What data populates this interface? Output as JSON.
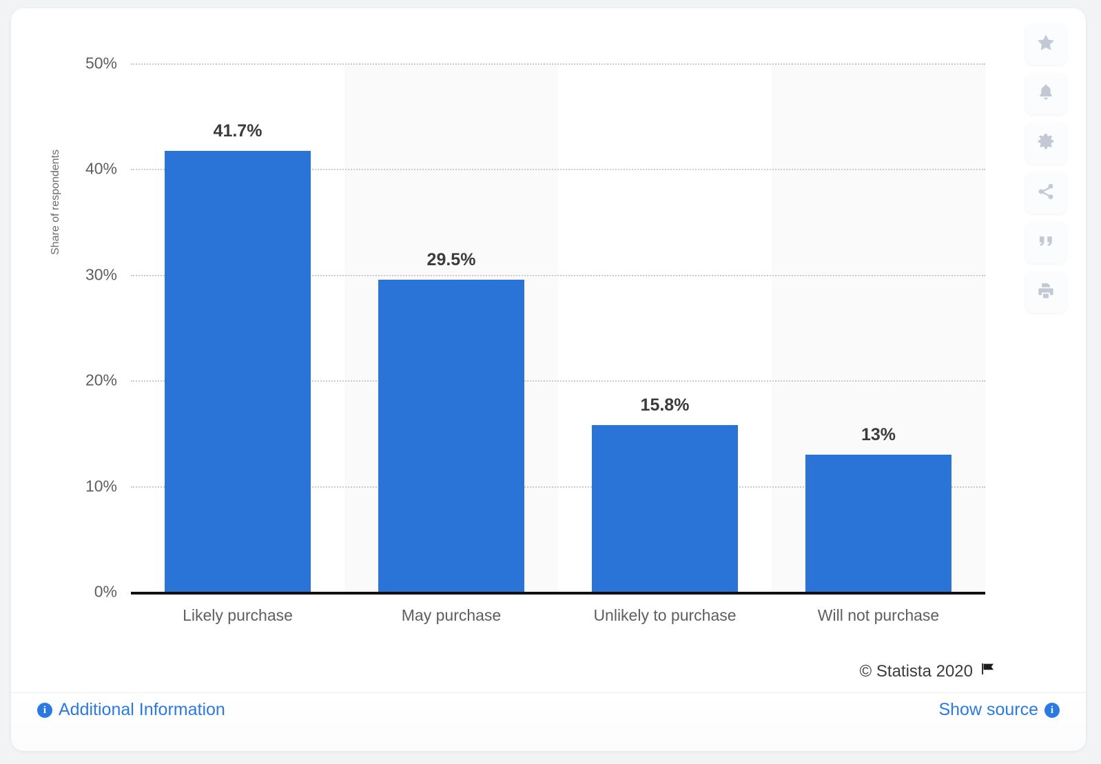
{
  "chart_data": {
    "type": "bar",
    "title": "",
    "xlabel": "",
    "ylabel": "Share of respondents",
    "ylim": [
      0,
      50
    ],
    "grid": true,
    "legend": "none",
    "categories": [
      "Likely purchase",
      "May purchase",
      "Unlikely to purchase",
      "Will not purchase"
    ],
    "values": [
      41.7,
      29.5,
      15.8,
      13
    ],
    "value_labels": [
      "41.7%",
      "29.5%",
      "15.8%",
      "13%"
    ],
    "y_ticks": [
      "0%",
      "10%",
      "20%",
      "30%",
      "40%",
      "50%"
    ],
    "y_tick_values": [
      0,
      10,
      20,
      30,
      40,
      50
    ],
    "bar_color": "#2a74d8"
  },
  "axis": {
    "y_title": "Share of respondents"
  },
  "toolbar": {
    "buttons": [
      {
        "name": "favorite",
        "icon": "star-icon"
      },
      {
        "name": "alert",
        "icon": "bell-icon"
      },
      {
        "name": "settings",
        "icon": "gear-icon"
      },
      {
        "name": "share",
        "icon": "share-icon"
      },
      {
        "name": "cite",
        "icon": "quote-icon"
      },
      {
        "name": "print",
        "icon": "print-icon"
      }
    ]
  },
  "footer": {
    "copyright": "© Statista 2020",
    "flag_icon": "flag-icon",
    "additional_information": "Additional Information",
    "show_source": "Show source",
    "info_glyph": "i"
  }
}
